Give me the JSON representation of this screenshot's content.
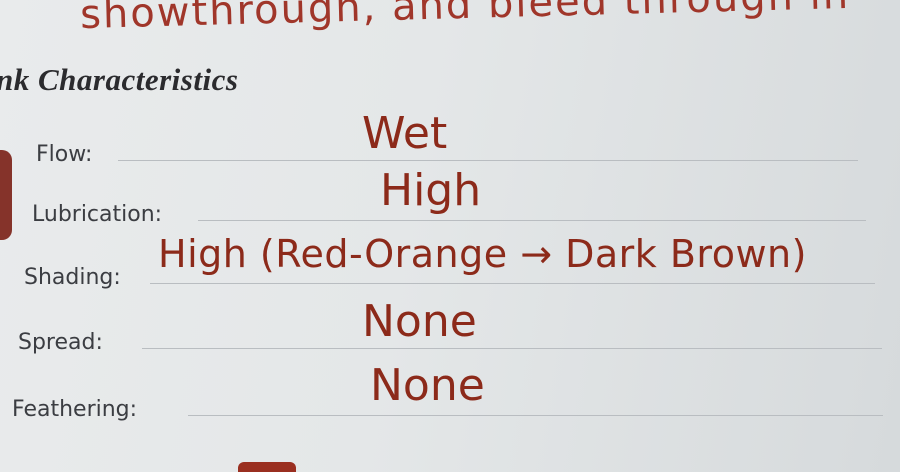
{
  "top_handwriting": "showthrough, and bleed through in",
  "section_title": "nk Characteristics",
  "rows": [
    {
      "label": "Flow:",
      "value": "Wet"
    },
    {
      "label": "Lubrication:",
      "value": "High"
    },
    {
      "label": "Shading:",
      "value": "High (Red-Orange → Dark Brown)"
    },
    {
      "label": "Spread:",
      "value": "None"
    },
    {
      "label": "Feathering:",
      "value": "None"
    }
  ],
  "colors": {
    "ink": "#8c2a1a",
    "printed_text": "#3b3d42",
    "paper": "#e7e9ea"
  }
}
